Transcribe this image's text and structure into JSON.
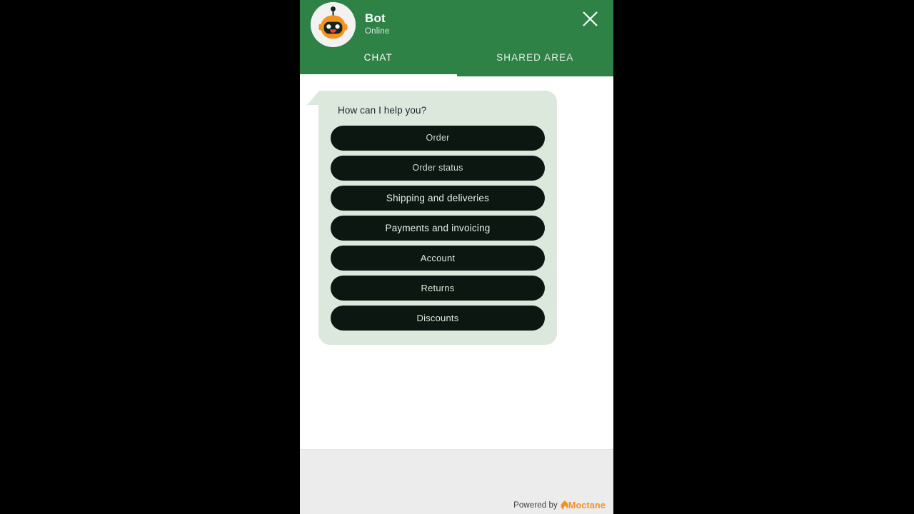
{
  "widget": {
    "header": {
      "bot_name": "Bot",
      "status": "Online",
      "avatar_icon": "robot-avatar-icon",
      "close_icon": "close-icon",
      "background_color": "#2E8246"
    },
    "tabs": [
      {
        "label": "CHAT",
        "active": true
      },
      {
        "label": "SHARED AREA",
        "active": false
      }
    ],
    "conversation": {
      "messages": [
        {
          "sender": "bot",
          "text": "How can I help you?",
          "bubble_color": "#DDE8DD",
          "options": [
            "Order",
            "Order status",
            "Shipping and deliveries",
            "Payments and invoicing",
            "Account",
            "Returns",
            "Discounts"
          ]
        }
      ]
    },
    "footer": {
      "powered_by_label": "Powered by",
      "brand_name": "Moctane",
      "brand_icon": "flame-icon",
      "brand_color": "#F5911E",
      "background_color": "#ECECEC"
    }
  }
}
